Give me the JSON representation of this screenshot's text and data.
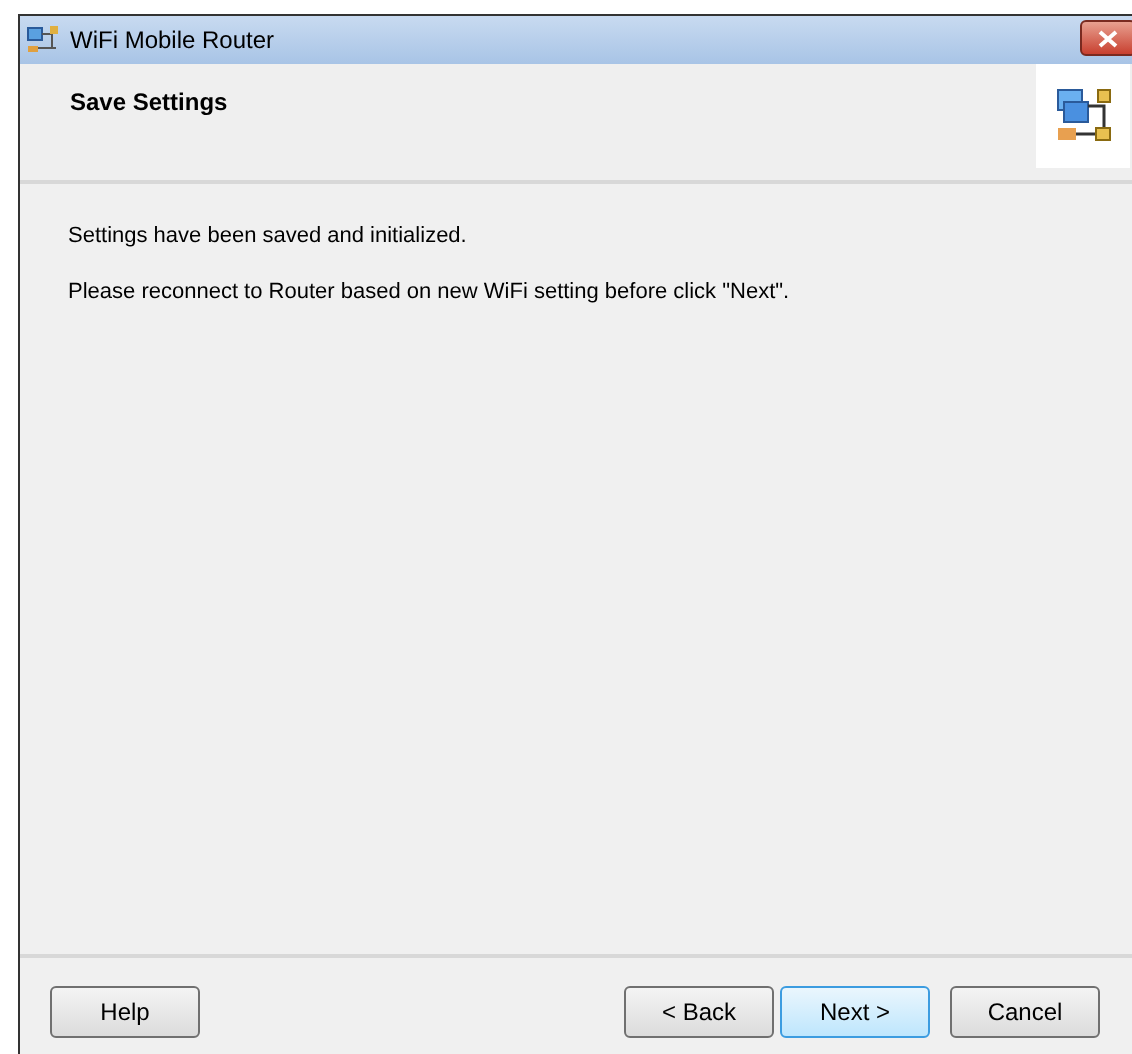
{
  "window": {
    "title": "WiFi Mobile Router"
  },
  "header": {
    "title": "Save Settings"
  },
  "messages": [
    "Settings have been saved and initialized.",
    "Please reconnect to Router based on new WiFi setting before click \"Next\"."
  ],
  "left_buttons": [
    {
      "label": "Help",
      "default": false
    }
  ],
  "right_buttons": [
    {
      "label": "< Back",
      "default": false
    },
    {
      "label": "Next >",
      "default": true
    },
    {
      "label": "Cancel",
      "default": false
    }
  ]
}
